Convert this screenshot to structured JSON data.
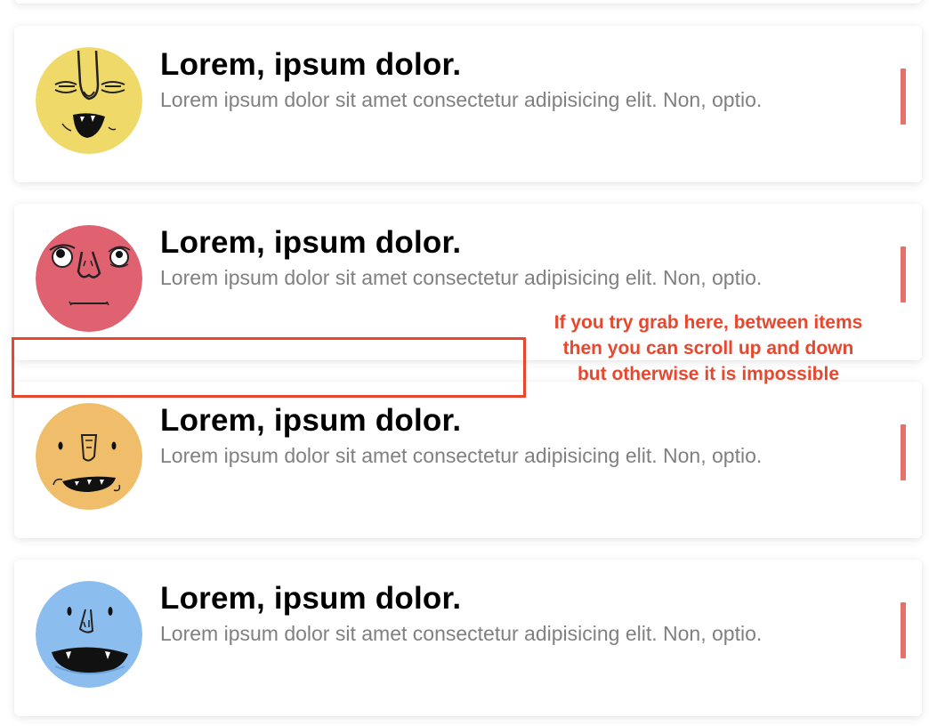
{
  "list": {
    "items": [
      {
        "title": "Lorem, ipsum dolor.",
        "description": "Lorem ipsum dolor sit amet consectetur adipisicing elit. Non, optio.",
        "avatar_color": "#efd969",
        "avatar_icon": "yellow-monster-face-icon"
      },
      {
        "title": "Lorem, ipsum dolor.",
        "description": "Lorem ipsum dolor sit amet consectetur adipisicing elit. Non, optio.",
        "avatar_color": "#e06170",
        "avatar_icon": "pink-monster-face-icon"
      },
      {
        "title": "Lorem, ipsum dolor.",
        "description": "Lorem ipsum dolor sit amet consectetur adipisicing elit. Non, optio.",
        "avatar_color": "#f0be6a",
        "avatar_icon": "orange-monster-face-icon"
      },
      {
        "title": "Lorem, ipsum dolor.",
        "description": "Lorem ipsum dolor sit amet consectetur adipisicing elit. Non, optio.",
        "avatar_color": "#8bbdee",
        "avatar_icon": "blue-monster-face-icon"
      }
    ],
    "handle_color": "#e8706b"
  },
  "annotation": {
    "lines": [
      "If you try grab here, between items",
      "then you can scroll up and down",
      "but otherwise it is impossible"
    ],
    "color": "#e8472e"
  }
}
